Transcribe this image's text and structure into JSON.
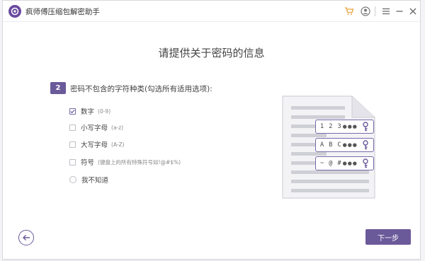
{
  "app": {
    "title": "疯师傅压缩包解密助手"
  },
  "main": {
    "heading": "请提供关于密码的信息",
    "step_number": "2",
    "question": "密码不包含的字符种类(勾选所有适用选项):"
  },
  "options": [
    {
      "label": "数字",
      "hint": "(0-9)",
      "checked": true,
      "type": "checkbox"
    },
    {
      "label": "小写字母",
      "hint": "(a-z)",
      "checked": false,
      "type": "checkbox"
    },
    {
      "label": "大写字母",
      "hint": "(A-Z)",
      "checked": false,
      "type": "checkbox"
    },
    {
      "label": "符号",
      "hint": "(键盘上的所有特殊符号如!@#$%)",
      "checked": false,
      "type": "checkbox"
    },
    {
      "label": "我不知道",
      "hint": "",
      "checked": false,
      "type": "radio"
    }
  ],
  "illustration": {
    "chips": [
      {
        "text": "1 2 3"
      },
      {
        "text": "A B C"
      },
      {
        "text": "~ @ #"
      }
    ]
  },
  "buttons": {
    "next": "下一步"
  },
  "colors": {
    "accent": "#6b5a9a",
    "cart": "#e8a23a"
  },
  "icons": [
    "app-logo-icon",
    "cart-icon",
    "user-icon",
    "menu-icon",
    "minimize-icon",
    "close-icon",
    "back-arrow-icon",
    "key-icon"
  ]
}
